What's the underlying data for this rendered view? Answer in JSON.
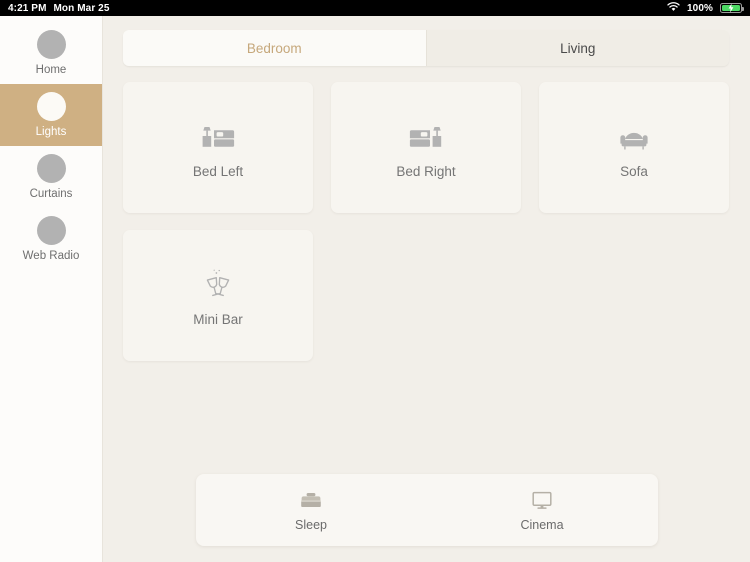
{
  "status_bar": {
    "time": "4:21 PM",
    "date": "Mon Mar 25",
    "battery_percent": "100%",
    "wifi_icon": "wifi-icon",
    "battery_icon": "battery-charging-icon",
    "battery_color": "#4cd964"
  },
  "sidebar": {
    "items": [
      {
        "label": "Home",
        "icon": "circle-icon",
        "active": false
      },
      {
        "label": "Lights",
        "icon": "circle-icon",
        "active": true
      },
      {
        "label": "Curtains",
        "icon": "circle-icon",
        "active": false
      },
      {
        "label": "Web Radio",
        "icon": "circle-icon",
        "active": false
      }
    ],
    "active_background": "#cfb083"
  },
  "tabs": [
    {
      "label": "Bedroom",
      "active": true
    },
    {
      "label": "Living",
      "active": false
    }
  ],
  "devices": [
    {
      "label": "Bed Left",
      "icon": "bed-left-icon"
    },
    {
      "label": "Bed Right",
      "icon": "bed-right-icon"
    },
    {
      "label": "Sofa",
      "icon": "sofa-icon"
    },
    {
      "label": "Mini Bar",
      "icon": "wine-glasses-icon"
    }
  ],
  "scenes": [
    {
      "label": "Sleep",
      "icon": "bed-icon"
    },
    {
      "label": "Cinema",
      "icon": "monitor-icon"
    }
  ],
  "colors": {
    "page_background": "#f2efe9",
    "card_background": "#f7f5f0",
    "accent": "#cfb083",
    "icon_grey": "#b2b2b2",
    "text_grey": "#757575"
  }
}
